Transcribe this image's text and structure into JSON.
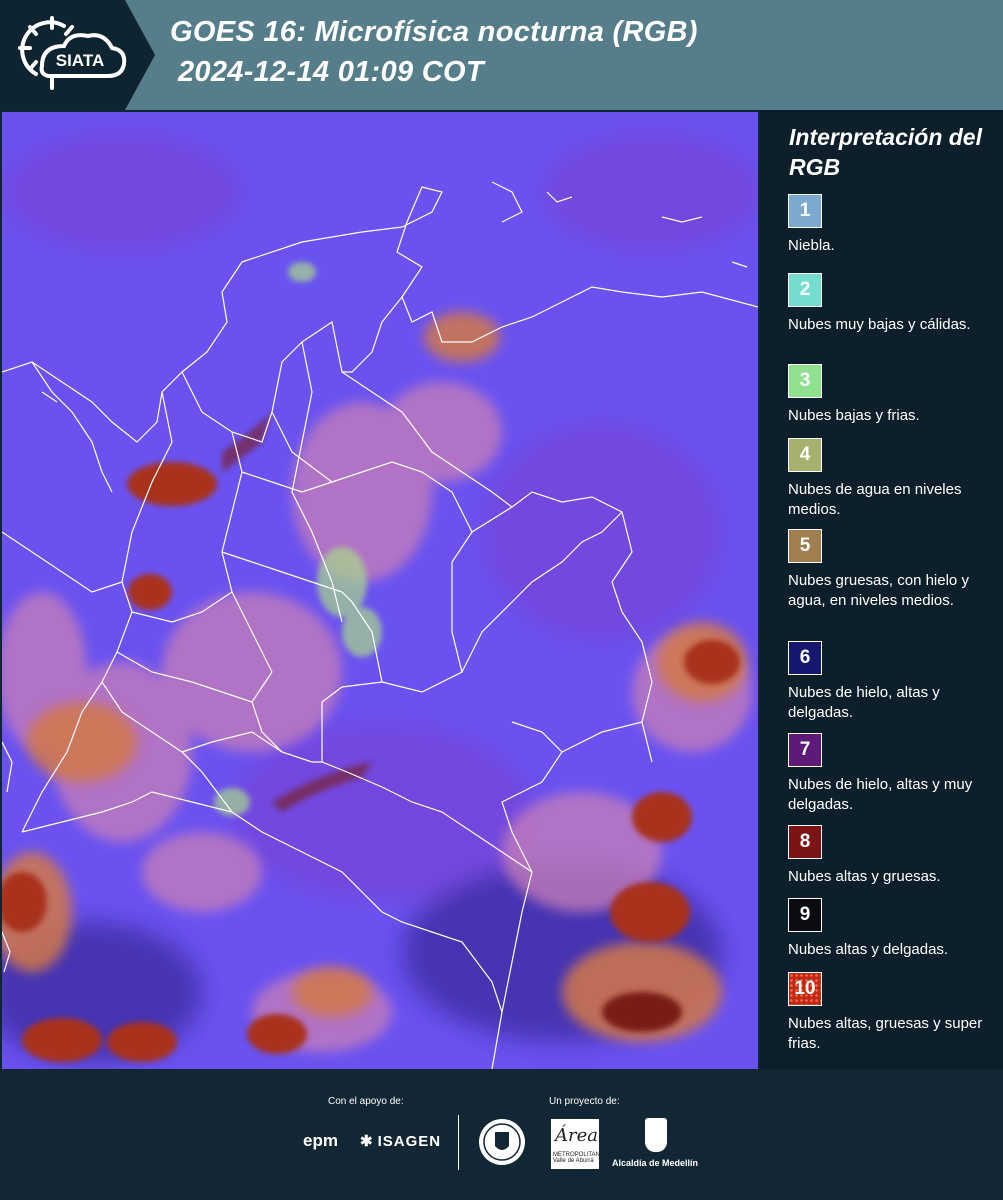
{
  "header": {
    "logo_text": "SIATA",
    "title_line1": "GOES 16: Microfísica nocturna (RGB)",
    "title_line2": "2024-12-14 01:09 COT"
  },
  "map": {
    "background_color": "#6a52f0",
    "cloud_colors": {
      "purple": "#7a3fd0",
      "pink": "#c97fb8",
      "orange": "#d2784a",
      "red": "#a8321a",
      "dark_red": "#7a1a12",
      "dark_blue": "#2a1a80",
      "green": "#a8d98a"
    },
    "border_color": "#ffffff"
  },
  "legend": {
    "title": "Interpretación del RGB",
    "items": [
      {
        "number": "1",
        "label": "Niebla.",
        "color": "#7ea9cf"
      },
      {
        "number": "2",
        "label": "Nubes muy bajas y cálidas.",
        "color": "#74ddd0"
      },
      {
        "number": "3",
        "label": "Nubes bajas y frias.",
        "color": "#8fe08f"
      },
      {
        "number": "4",
        "label": "Nubes de agua en niveles medios.",
        "color": "#a7b16f"
      },
      {
        "number": "5",
        "label": "Nubes gruesas, con hielo y agua, en niveles medios.",
        "color": "#a07e4f"
      },
      {
        "number": "6",
        "label": "Nubes de hielo, altas y delgadas.",
        "color": "#161870"
      },
      {
        "number": "7",
        "label": "Nubes de hielo, altas y muy delgadas.",
        "color": "#5e1a78"
      },
      {
        "number": "8",
        "label": "Nubes altas y gruesas.",
        "color": "#7d1414"
      },
      {
        "number": "9",
        "label": "Nubes altas y delgadas.",
        "color": "#0b0b12"
      },
      {
        "number": "10",
        "label": "Nubes altas, gruesas y super frias.",
        "color": "#c02a14"
      }
    ]
  },
  "footer": {
    "support_label": "Con el apoyo de:",
    "project_label": "Un proyecto de:",
    "sponsor_epm": "epm",
    "sponsor_isagen": "ISAGEN",
    "metro_logo": "Área",
    "metro_sub": "METROPOLITANA Valle de Aburrá",
    "alcaldia": "Alcaldía de Medellín"
  }
}
